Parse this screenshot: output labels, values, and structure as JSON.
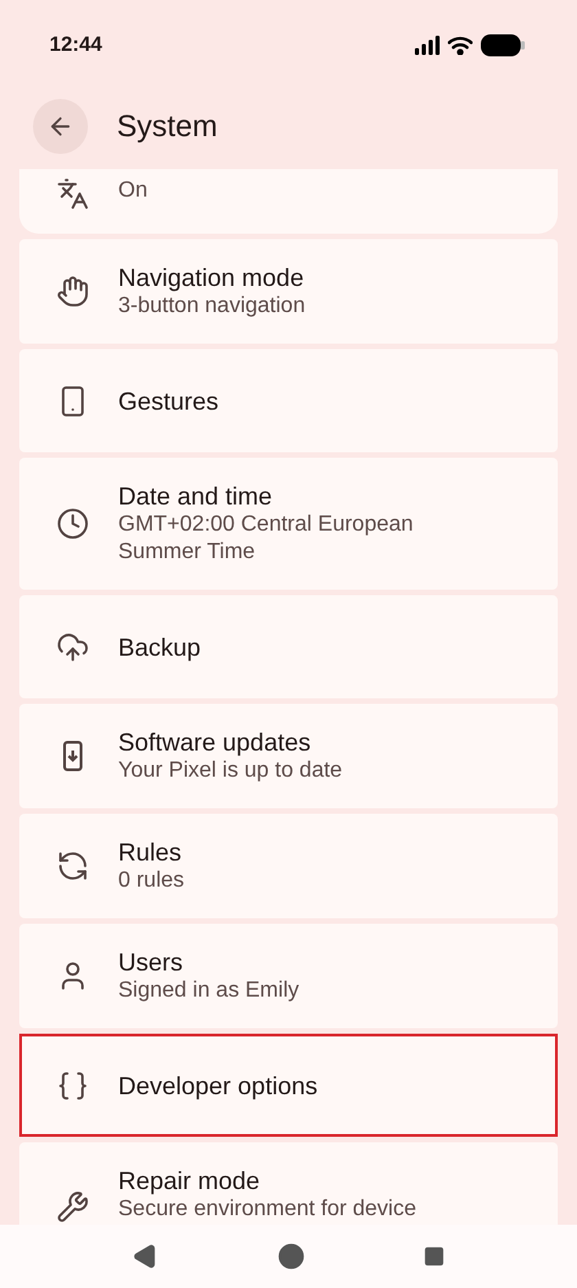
{
  "status_bar": {
    "time": "12:44"
  },
  "header": {
    "title": "System"
  },
  "items": [
    {
      "subtitle": "On",
      "highlighted": false
    },
    {
      "title": "Navigation mode",
      "subtitle": "3-button navigation",
      "highlighted": false
    },
    {
      "title": "Gestures",
      "highlighted": false
    },
    {
      "title": "Date and time",
      "subtitle": "GMT+02:00 Central European Summer Time",
      "highlighted": false
    },
    {
      "title": "Backup",
      "highlighted": false
    },
    {
      "title": "Software updates",
      "subtitle": "Your Pixel is up to date",
      "highlighted": false
    },
    {
      "title": "Rules",
      "subtitle": "0 rules",
      "highlighted": false
    },
    {
      "title": "Users",
      "subtitle": "Signed in as Emily",
      "highlighted": false
    },
    {
      "title": "Developer options",
      "highlighted": true
    },
    {
      "title": "Repair mode",
      "subtitle": "Secure environment for device",
      "highlighted": false
    }
  ]
}
